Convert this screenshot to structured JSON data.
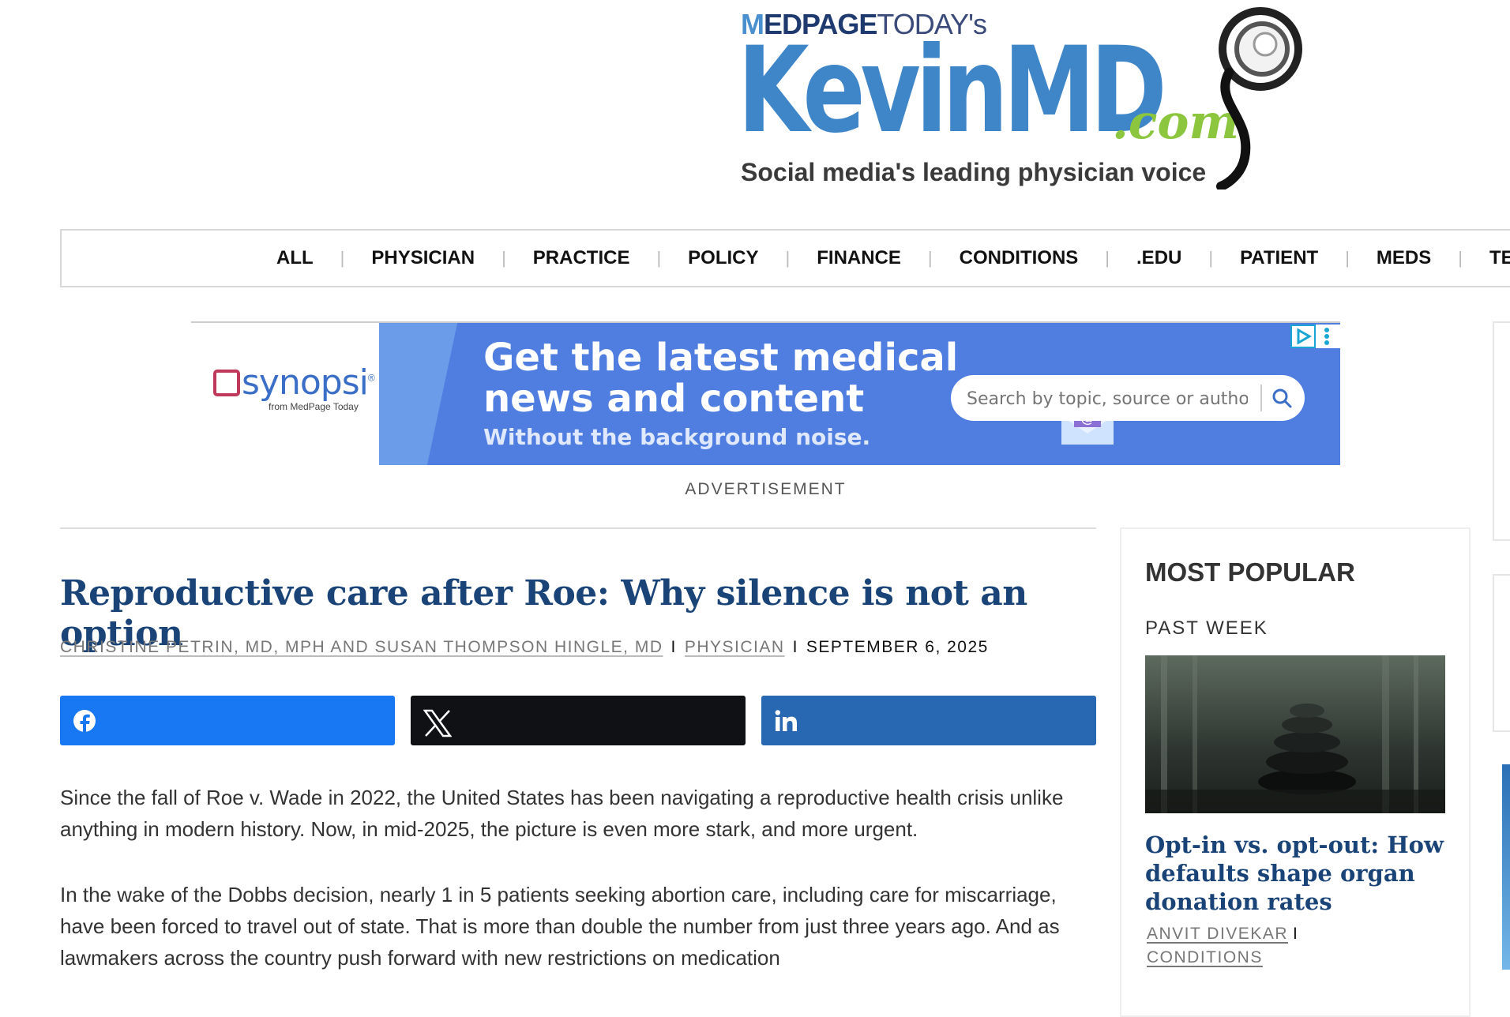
{
  "site": {
    "logo_top_a": "M",
    "logo_top_b": "EDPAGE",
    "logo_top_c": "TODAY's",
    "logo_main": "KevinMD",
    "logo_com": ".com",
    "logo_tagline": "Social media's leading physician voice"
  },
  "nav": {
    "items": [
      "ALL",
      "PHYSICIAN",
      "PRACTICE",
      "POLICY",
      "FINANCE",
      "CONDITIONS",
      ".EDU",
      "PATIENT",
      "MEDS",
      "TEC"
    ],
    "separator": "|"
  },
  "ad": {
    "brand": "synopsi",
    "brand_mark": "®",
    "brand_from": "from MedPage Today",
    "headline_line1": "Get the latest medical",
    "headline_line2": "news and content",
    "subhead": "Without the background noise.",
    "search_placeholder": "Search by topic, source or author",
    "label": "ADVERTISEMENT"
  },
  "article": {
    "title": "Reproductive care after Roe: Why silence is not an option",
    "authors": "CHRISTINE PETRIN, MD, MPH AND SUSAN THOMPSON HINGLE, MD",
    "category": "PHYSICIAN",
    "date": "SEPTEMBER 6, 2025",
    "byline_sep": "I",
    "paragraphs": [
      "Since the fall of Roe v. Wade in 2022, the United States has been navigating a reproductive health crisis unlike anything in modern history. Now, in mid-2025, the picture is even more stark, and more urgent.",
      "In the wake of the Dobbs decision, nearly 1 in 5 patients seeking abortion care, including care for miscarriage, have been forced to travel out of state. That is more than double the number from just three years ago. And as lawmakers across the country push forward with new restrictions on medication"
    ]
  },
  "share": {
    "facebook_icon": "facebook-icon",
    "x_icon": "x-icon",
    "linkedin_icon": "linkedin-icon",
    "colors": {
      "facebook": "#1877f2",
      "x": "#0f1114",
      "linkedin": "#2867b2"
    }
  },
  "sidebar": {
    "heading": "MOST POPULAR",
    "subheading": "PAST WEEK",
    "item": {
      "title": "Opt-in vs. opt-out: How defaults shape organ donation rates",
      "author": "ANVIT DIVEKAR",
      "category": "CONDITIONS",
      "sep": "I"
    }
  },
  "colors": {
    "title": "#1a4478",
    "logo_blue": "#3f86c9",
    "logo_green": "#8cc63e",
    "ad_blue": "#4f7ee0"
  }
}
